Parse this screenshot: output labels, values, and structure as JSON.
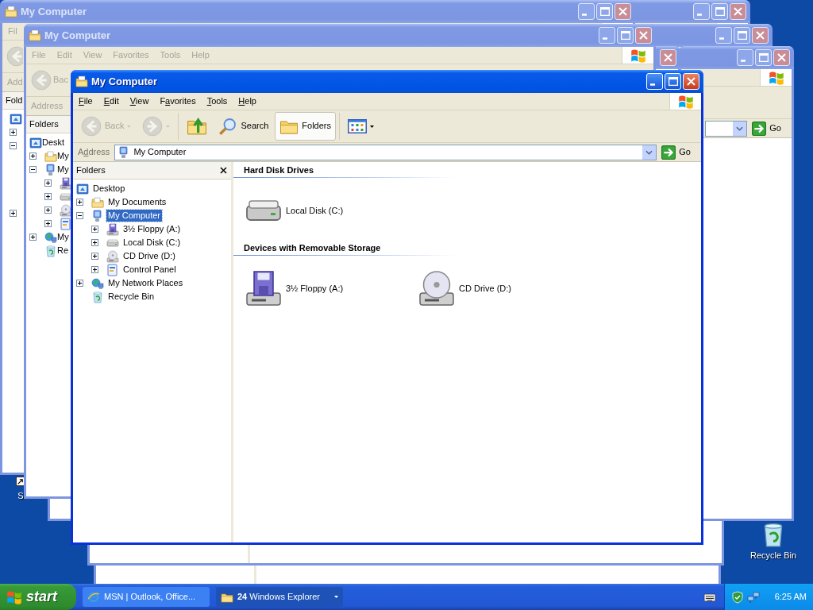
{
  "desktop_icons": [
    {
      "label": "S",
      "kind": "shortcut"
    },
    {
      "label": "Recycle Bin",
      "kind": "recycle"
    }
  ],
  "background_windows": [
    {
      "title": "My Computer",
      "menu": [
        "Fil"
      ],
      "toolbar": [
        {
          "kind": "back",
          "disabled": true
        }
      ],
      "address_label": "Add",
      "folders_label": "Fold",
      "tree": [
        {
          "kind": "desktop",
          "children": [
            {
              "expanded": false
            },
            {
              "expanded": true
            },
            {
              "expanded": false
            }
          ]
        }
      ]
    },
    {
      "title": "My Computer",
      "menu": [
        "File",
        "Edit",
        "View",
        "Favorites",
        "Tools",
        "Help"
      ],
      "toolbar": [
        {
          "kind": "back",
          "label": "Bac",
          "disabled": true
        }
      ],
      "address_label": "Address",
      "folders_label": "Folders",
      "tree": [
        {
          "label": "Deskt",
          "kind": "desktop",
          "selected": false,
          "children": [
            {
              "label": "My",
              "kind": "documents",
              "expanded": false,
              "selected": false
            },
            {
              "label": "My",
              "kind": "computer",
              "expanded": true,
              "selected": false,
              "children": [
                {
                  "kind": "floppy",
                  "expanded": false
                },
                {
                  "kind": "hdd",
                  "expanded": false
                },
                {
                  "kind": "cd",
                  "expanded": false
                },
                {
                  "kind": "control-panel",
                  "expanded": false
                }
              ]
            },
            {
              "label": "My",
              "kind": "network",
              "expanded": false,
              "selected": false
            },
            {
              "label": "Re",
              "kind": "recycle",
              "selected": false
            }
          ]
        }
      ]
    },
    {
      "go_label": "Go"
    }
  ],
  "window": {
    "title": "My Computer",
    "menu": [
      {
        "key": "F",
        "post": "ile"
      },
      {
        "key": "E",
        "post": "dit"
      },
      {
        "key": "V",
        "post": "iew"
      },
      {
        "pre": "F",
        "key": "a",
        "post": "vorites"
      },
      {
        "key": "T",
        "post": "ools"
      },
      {
        "key": "H",
        "post": "elp"
      }
    ],
    "toolbar": [
      {
        "kind": "back",
        "label": "Back",
        "disabled": true
      },
      {
        "kind": "forward",
        "disabled": true
      },
      {
        "kind": "up",
        "disabled": false
      },
      {
        "kind": "search",
        "label": "Search",
        "selected": false
      },
      {
        "kind": "folders",
        "label": "Folders",
        "selected": true
      },
      {
        "kind": "views"
      }
    ],
    "address_label": {
      "pre": "A",
      "key": "d",
      "post": "dress"
    },
    "address": "My Computer",
    "go_label": "Go",
    "folders_label": "Folders",
    "tree": [
      {
        "label": "Desktop",
        "kind": "desktop",
        "selected": false,
        "children": [
          {
            "label": "My Documents",
            "kind": "documents",
            "expanded": false,
            "selected": false
          },
          {
            "label": "My Computer",
            "kind": "computer",
            "expanded": true,
            "selected": true,
            "children": [
              {
                "label": "3½ Floppy (A:)",
                "kind": "floppy",
                "expanded": false,
                "selected": false
              },
              {
                "label": "Local Disk (C:)",
                "kind": "hdd",
                "expanded": false,
                "selected": false
              },
              {
                "label": "CD Drive (D:)",
                "kind": "cd",
                "expanded": false,
                "selected": false
              },
              {
                "label": "Control Panel",
                "kind": "control-panel",
                "expanded": false,
                "selected": false
              }
            ]
          },
          {
            "label": "My Network Places",
            "kind": "network",
            "expanded": false,
            "selected": false
          },
          {
            "label": "Recycle Bin",
            "kind": "recycle",
            "selected": false
          }
        ]
      }
    ],
    "groups": [
      {
        "title": "Hard Disk Drives",
        "items": [
          {
            "label": "Local Disk (C:)",
            "kind": "hdd",
            "selected": false
          }
        ]
      },
      {
        "title": "Devices with Removable Storage",
        "items": [
          {
            "label": "3½ Floppy (A:)",
            "kind": "floppy",
            "selected": false
          },
          {
            "label": "CD Drive (D:)",
            "kind": "cd",
            "selected": false
          }
        ]
      }
    ]
  },
  "taskbar": {
    "start": "start",
    "tasks": [
      {
        "kind": "ie",
        "label": "MSN | Outlook, Office...",
        "selected": false,
        "grouped": false
      },
      {
        "kind": "folder",
        "label": "**24** Windows Explorer",
        "selected": true,
        "grouped": true
      }
    ],
    "clock": "6:25 AM"
  }
}
